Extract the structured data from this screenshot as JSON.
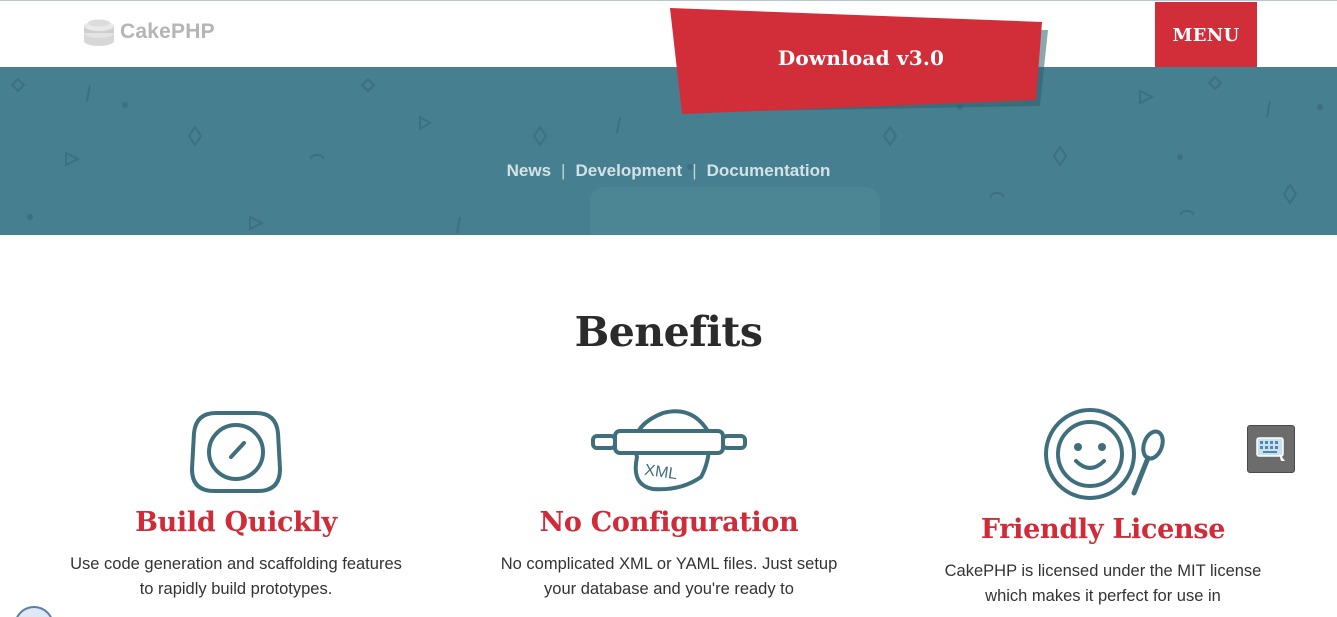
{
  "header": {
    "logo_text": "CakePHP",
    "menu_label": "MENU"
  },
  "hero": {
    "download_label": "Download v3.0",
    "nav": [
      {
        "label": "News"
      },
      {
        "label": "Development"
      },
      {
        "label": "Documentation"
      }
    ],
    "separator": "|"
  },
  "benefits": {
    "title": "Benefits",
    "items": [
      {
        "title": "Build Quickly",
        "text": "Use code generation and scaffolding features to rapidly build prototypes.",
        "icon": "timer-icon"
      },
      {
        "title": "No Configuration",
        "text": "No complicated XML or YAML files. Just setup your database and you're ready to",
        "icon": "rolling-pin-icon",
        "icon_text": "XML"
      },
      {
        "title": "Friendly License",
        "text": "CakePHP is licensed under the MIT license which makes it perfect for use in",
        "icon": "smiley-plate-icon"
      }
    ]
  },
  "colors": {
    "brand_red": "#d22e3a",
    "hero_teal": "#467f8f",
    "icon_teal": "#3f6f7d"
  }
}
